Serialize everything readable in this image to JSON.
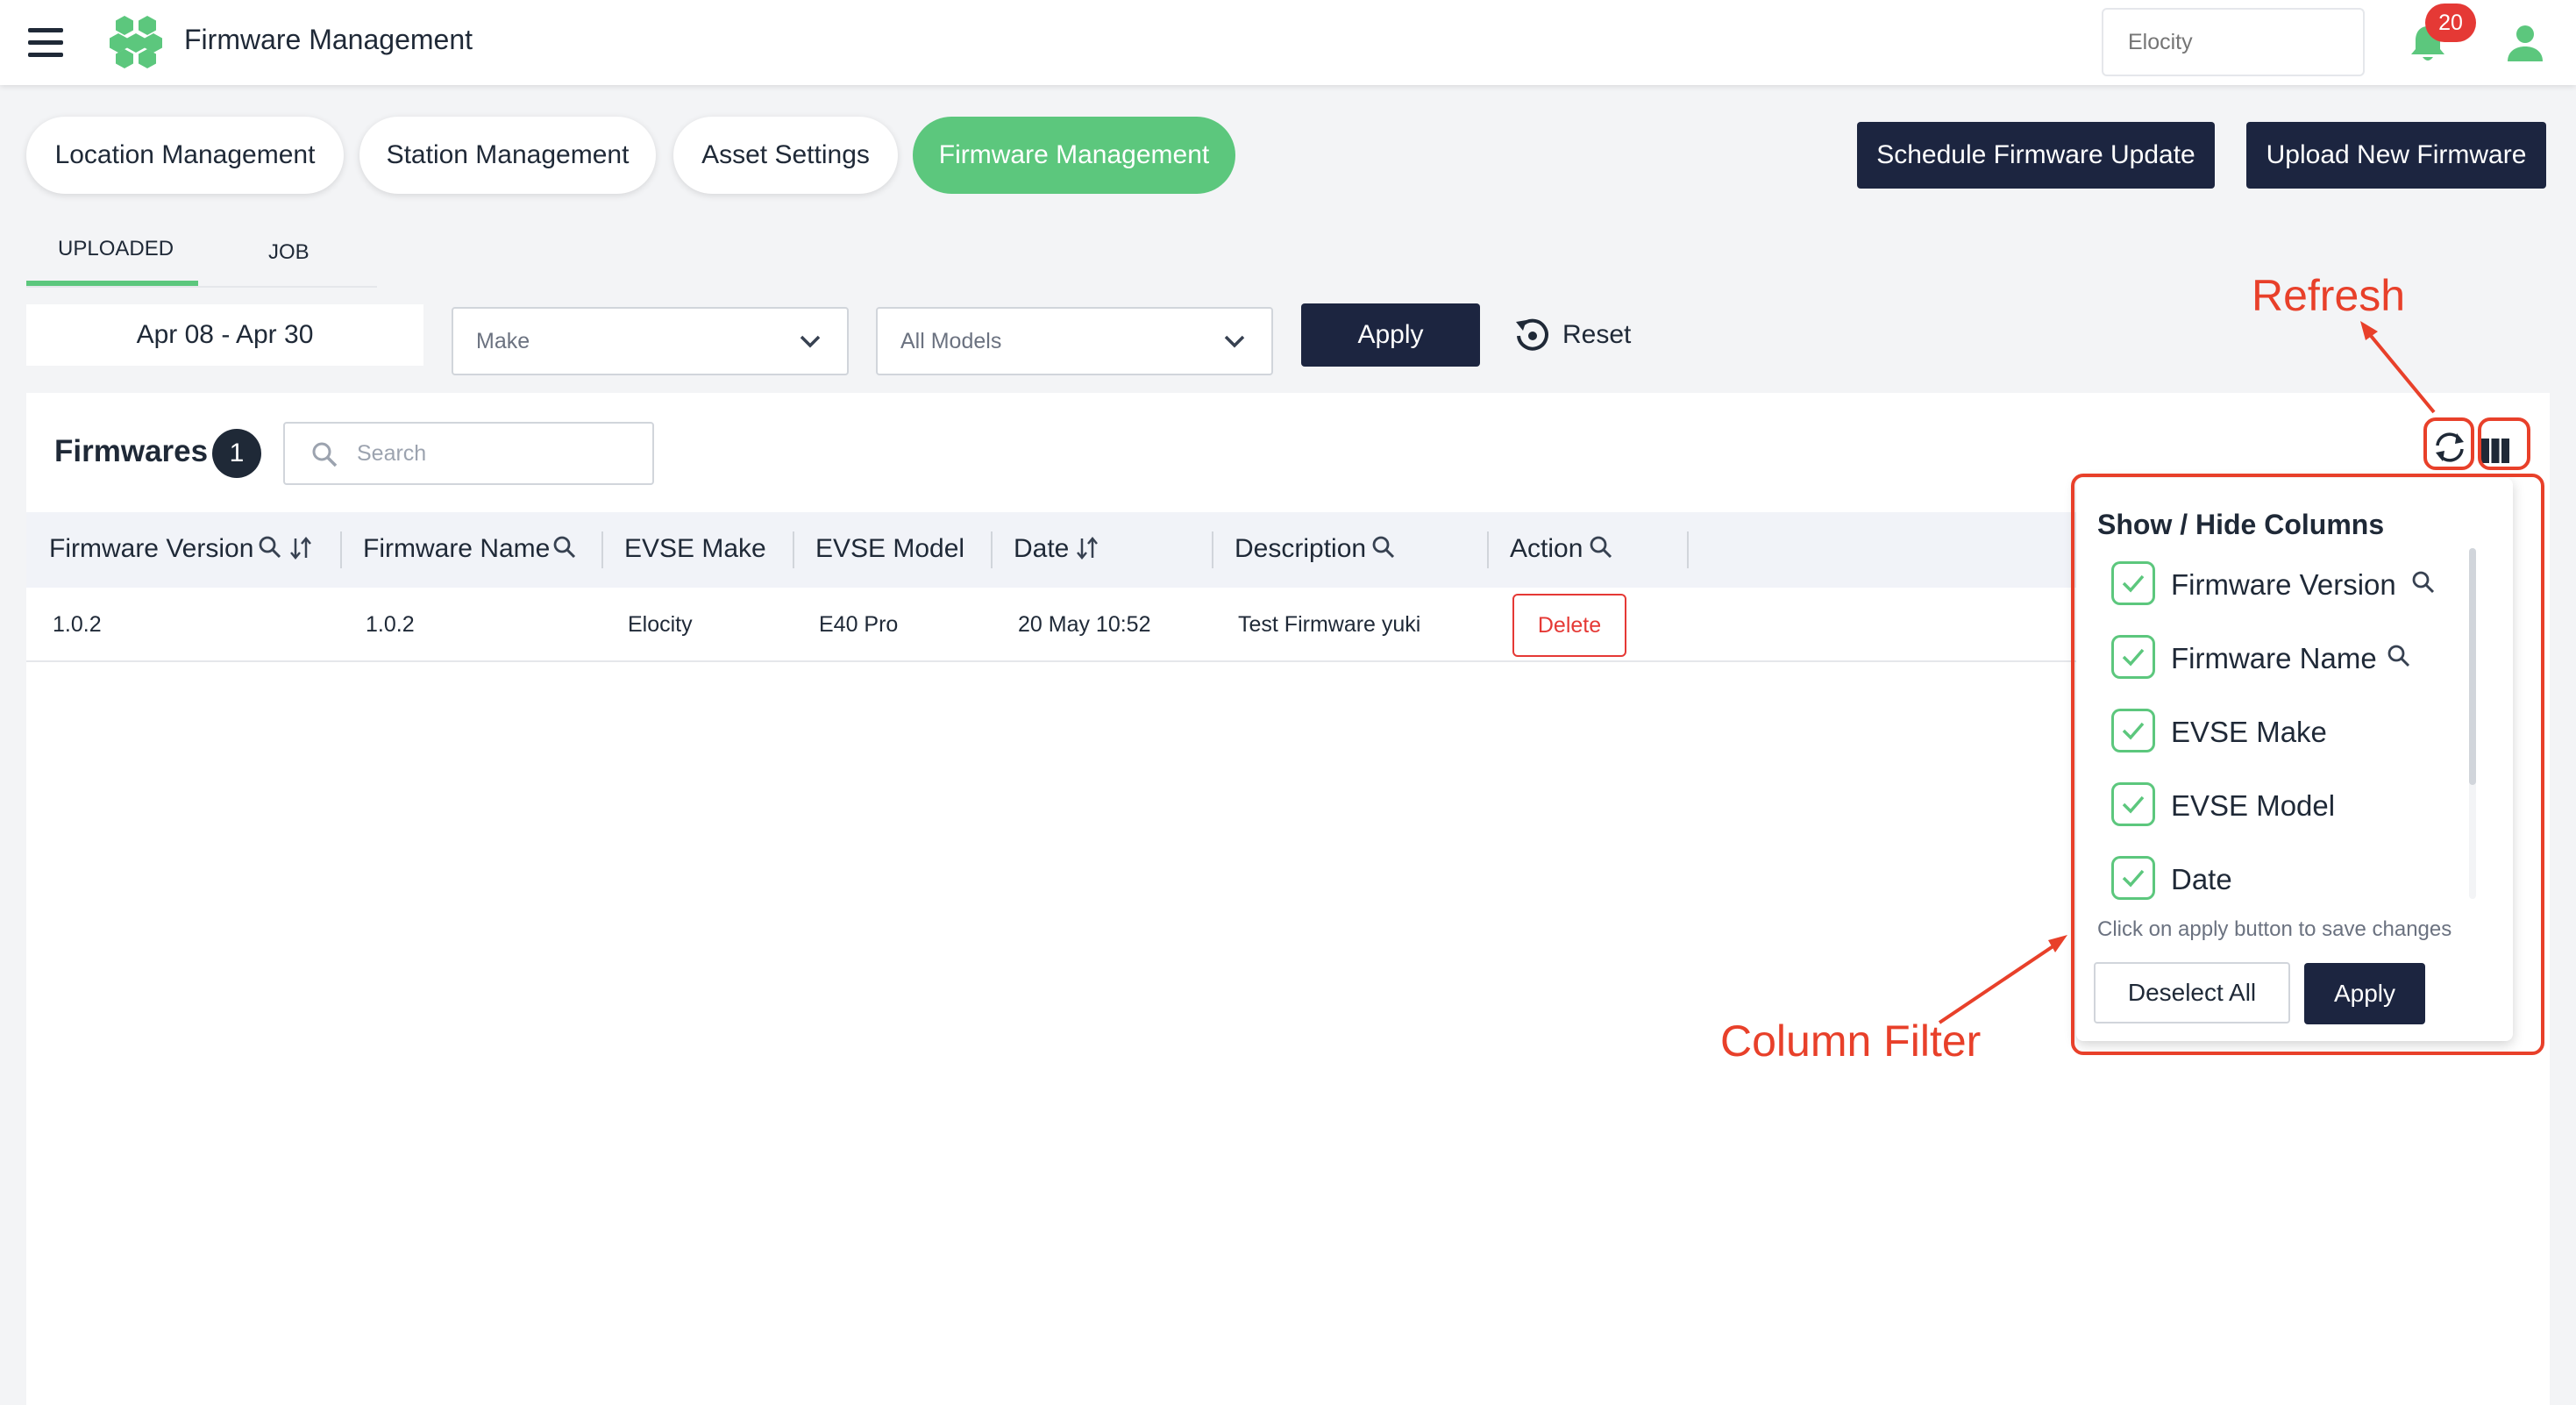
{
  "header": {
    "app_title": "Firmware Management",
    "company_placeholder": "Elocity",
    "notification_count": "20",
    "brand_color": "#5cc77d"
  },
  "nav_pills": [
    {
      "label": "Location Management"
    },
    {
      "label": "Station Management"
    },
    {
      "label": "Asset Settings"
    },
    {
      "label": "Firmware Management",
      "active": true
    }
  ],
  "actions": {
    "schedule_update": "Schedule Firmware Update",
    "upload_firmware": "Upload New Firmware"
  },
  "tabs": {
    "uploaded": "UPLOADED",
    "job": "JOB"
  },
  "filters": {
    "date_range": "Apr 08 - Apr 30",
    "make_placeholder": "Make",
    "models_value": "All Models",
    "apply": "Apply",
    "reset": "Reset"
  },
  "table": {
    "title": "Firmwares",
    "count": "1",
    "search_placeholder": "Search",
    "columns": [
      {
        "label": "Firmware Version"
      },
      {
        "label": "Firmware Name"
      },
      {
        "label": "EVSE Make"
      },
      {
        "label": "EVSE Model"
      },
      {
        "label": "Date"
      },
      {
        "label": "Description"
      },
      {
        "label": "Action"
      }
    ],
    "rows": [
      {
        "firmware_version": "1.0.2",
        "firmware_name": "1.0.2",
        "evse_make": "Elocity",
        "evse_model": "E40 Pro",
        "date": "20 May 10:52",
        "description": "Test Firmware yuki",
        "action": "Delete"
      }
    ]
  },
  "column_filter": {
    "title": "Show / Hide Columns",
    "items": [
      {
        "label": "Firmware Version",
        "checked": true
      },
      {
        "label": "Firmware Name",
        "checked": true
      },
      {
        "label": "EVSE Make",
        "checked": true
      },
      {
        "label": "EVSE Model",
        "checked": true
      },
      {
        "label": "Date",
        "checked": true
      }
    ],
    "hint": "Click on apply button to save changes",
    "deselect_all": "Deselect All",
    "apply": "Apply"
  },
  "annotations": {
    "refresh": "Refresh",
    "column_filter": "Column Filter",
    "color": "#e8402a"
  }
}
